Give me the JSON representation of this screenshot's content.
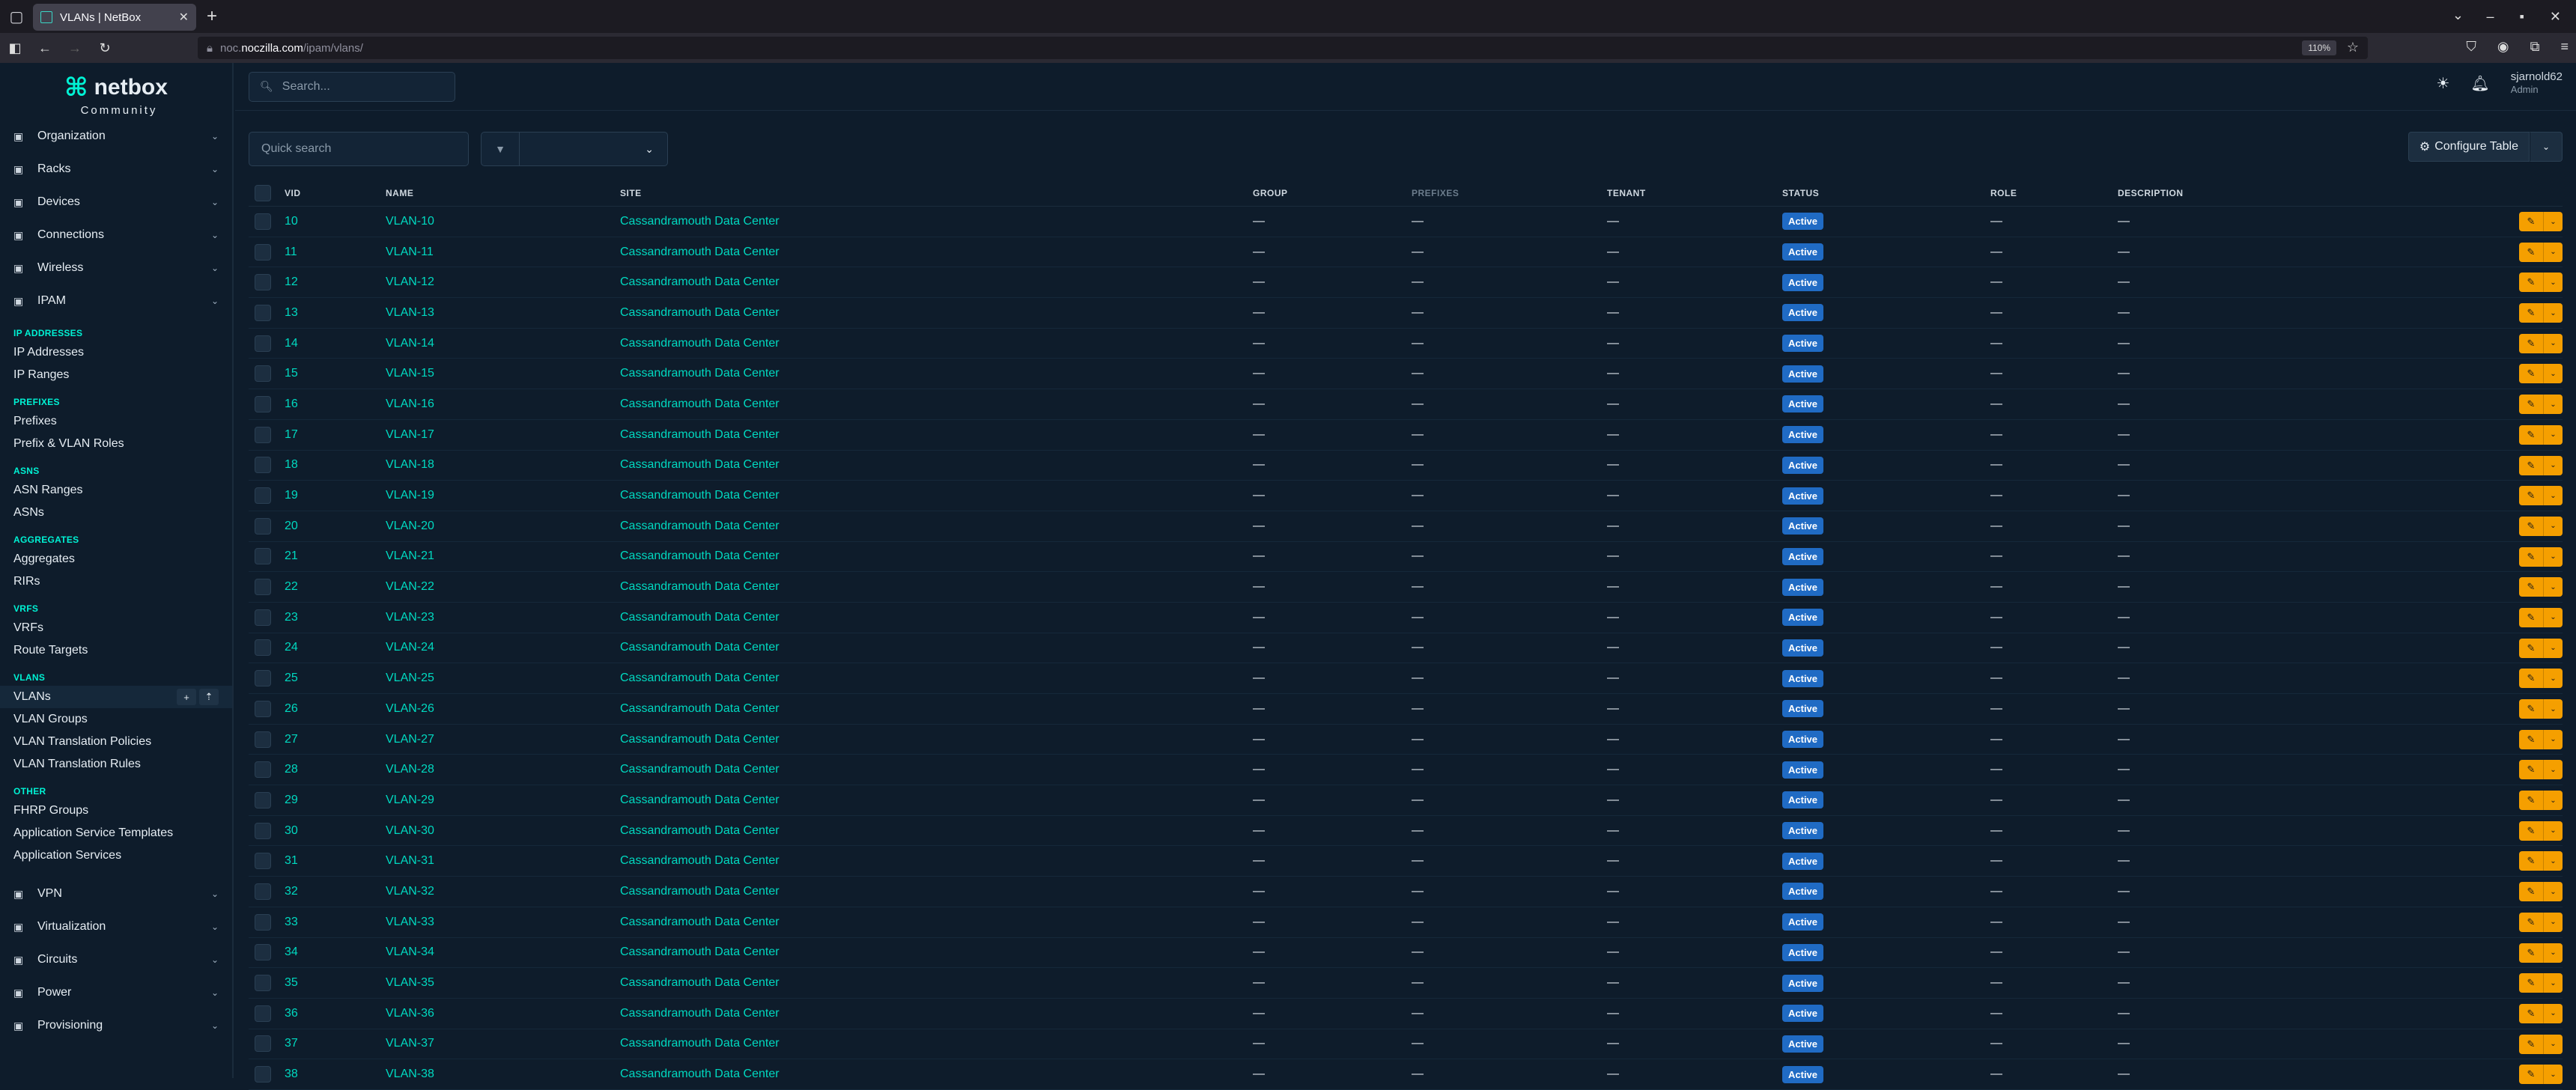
{
  "browser": {
    "tab_title": "VLANs | NetBox",
    "url_prefix": "noc.",
    "url_host": "noczilla.com",
    "url_path": "/ipam/vlans/",
    "zoom": "110%"
  },
  "sidebar": {
    "logo_text": "netbox",
    "logo_sub": "Community",
    "menus_top": [
      {
        "label": "Organization",
        "icon": "building-icon"
      },
      {
        "label": "Racks",
        "icon": "rack-icon"
      },
      {
        "label": "Devices",
        "icon": "server-icon"
      },
      {
        "label": "Connections",
        "icon": "connection-icon"
      },
      {
        "label": "Wireless",
        "icon": "wifi-icon"
      },
      {
        "label": "IPAM",
        "icon": "ipam-icon"
      }
    ],
    "sections": [
      {
        "head": "IP ADDRESSES",
        "items": [
          "IP Addresses",
          "IP Ranges"
        ]
      },
      {
        "head": "PREFIXES",
        "items": [
          "Prefixes",
          "Prefix & VLAN Roles"
        ]
      },
      {
        "head": "ASNS",
        "items": [
          "ASN Ranges",
          "ASNs"
        ]
      },
      {
        "head": "AGGREGATES",
        "items": [
          "Aggregates",
          "RIRs"
        ]
      },
      {
        "head": "VRFS",
        "items": [
          "VRFs",
          "Route Targets"
        ]
      },
      {
        "head": "VLANS",
        "items": [
          "VLANs",
          "VLAN Groups",
          "VLAN Translation Policies",
          "VLAN Translation Rules"
        ]
      },
      {
        "head": "OTHER",
        "items": [
          "FHRP Groups",
          "Application Service Templates",
          "Application Services"
        ]
      }
    ],
    "menus_bottom": [
      {
        "label": "VPN",
        "icon": "vpn-icon"
      },
      {
        "label": "Virtualization",
        "icon": "monitor-icon"
      },
      {
        "label": "Circuits",
        "icon": "circuit-icon"
      },
      {
        "label": "Power",
        "icon": "power-icon"
      },
      {
        "label": "Provisioning",
        "icon": "provisioning-icon"
      }
    ]
  },
  "topbar": {
    "search_placeholder": "Search...",
    "username": "sjarnold62",
    "role": "Admin"
  },
  "controls": {
    "quick_search_placeholder": "Quick search",
    "configure_label": "Configure Table"
  },
  "table": {
    "headers": {
      "vid": "VID",
      "name": "NAME",
      "site": "SITE",
      "group": "GROUP",
      "prefixes": "PREFIXES",
      "tenant": "TENANT",
      "status": "STATUS",
      "role": "ROLE",
      "description": "DESCRIPTION"
    },
    "site": "Cassandramouth Data Center",
    "status": "Active",
    "dash": "—",
    "rows": [
      {
        "vid": "10",
        "name": "VLAN-10"
      },
      {
        "vid": "11",
        "name": "VLAN-11"
      },
      {
        "vid": "12",
        "name": "VLAN-12"
      },
      {
        "vid": "13",
        "name": "VLAN-13"
      },
      {
        "vid": "14",
        "name": "VLAN-14"
      },
      {
        "vid": "15",
        "name": "VLAN-15"
      },
      {
        "vid": "16",
        "name": "VLAN-16"
      },
      {
        "vid": "17",
        "name": "VLAN-17"
      },
      {
        "vid": "18",
        "name": "VLAN-18"
      },
      {
        "vid": "19",
        "name": "VLAN-19"
      },
      {
        "vid": "20",
        "name": "VLAN-20"
      },
      {
        "vid": "21",
        "name": "VLAN-21"
      },
      {
        "vid": "22",
        "name": "VLAN-22"
      },
      {
        "vid": "23",
        "name": "VLAN-23"
      },
      {
        "vid": "24",
        "name": "VLAN-24"
      },
      {
        "vid": "25",
        "name": "VLAN-25"
      },
      {
        "vid": "26",
        "name": "VLAN-26"
      },
      {
        "vid": "27",
        "name": "VLAN-27"
      },
      {
        "vid": "28",
        "name": "VLAN-28"
      },
      {
        "vid": "29",
        "name": "VLAN-29"
      },
      {
        "vid": "30",
        "name": "VLAN-30"
      },
      {
        "vid": "31",
        "name": "VLAN-31"
      },
      {
        "vid": "32",
        "name": "VLAN-32"
      },
      {
        "vid": "33",
        "name": "VLAN-33"
      },
      {
        "vid": "34",
        "name": "VLAN-34"
      },
      {
        "vid": "35",
        "name": "VLAN-35"
      },
      {
        "vid": "36",
        "name": "VLAN-36"
      },
      {
        "vid": "37",
        "name": "VLAN-37"
      },
      {
        "vid": "38",
        "name": "VLAN-38"
      }
    ]
  },
  "colors": {
    "accent": "#00f2d4",
    "link": "#00d9c0",
    "status_active": "#206bc4",
    "edit": "#f59f00"
  }
}
